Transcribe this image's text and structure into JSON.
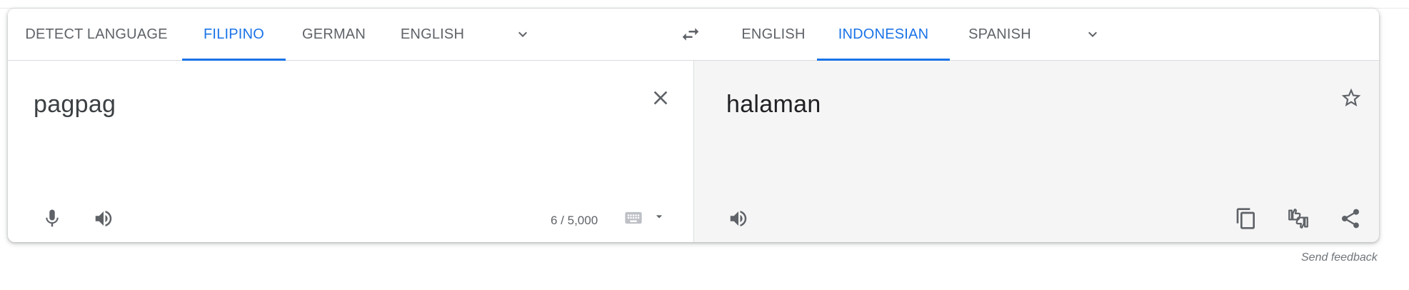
{
  "source_languages": {
    "tabs": [
      {
        "label": "DETECT LANGUAGE",
        "active": false
      },
      {
        "label": "FILIPINO",
        "active": true
      },
      {
        "label": "GERMAN",
        "active": false
      },
      {
        "label": "ENGLISH",
        "active": false
      }
    ],
    "more_icon": "chevron-down-icon"
  },
  "swap_icon": "swap-horizontal-icon",
  "target_languages": {
    "tabs": [
      {
        "label": "ENGLISH",
        "active": false
      },
      {
        "label": "INDONESIAN",
        "active": true
      },
      {
        "label": "SPANISH",
        "active": false
      }
    ],
    "more_icon": "chevron-down-icon"
  },
  "source": {
    "text": "pagpag",
    "char_count": "6 / 5,000",
    "icons": [
      "close-icon",
      "microphone-icon",
      "speaker-icon",
      "keyboard-icon",
      "dropdown-arrow-icon"
    ]
  },
  "target": {
    "text": "halaman",
    "icons": [
      "star-icon",
      "speaker-icon",
      "copy-icon",
      "rate-translation-icon",
      "share-icon"
    ]
  },
  "footer": {
    "send_feedback": "Send feedback"
  },
  "colors": {
    "accent": "#1a73e8",
    "text_secondary": "#5f6368",
    "target_pane_bg": "#f5f5f5"
  }
}
